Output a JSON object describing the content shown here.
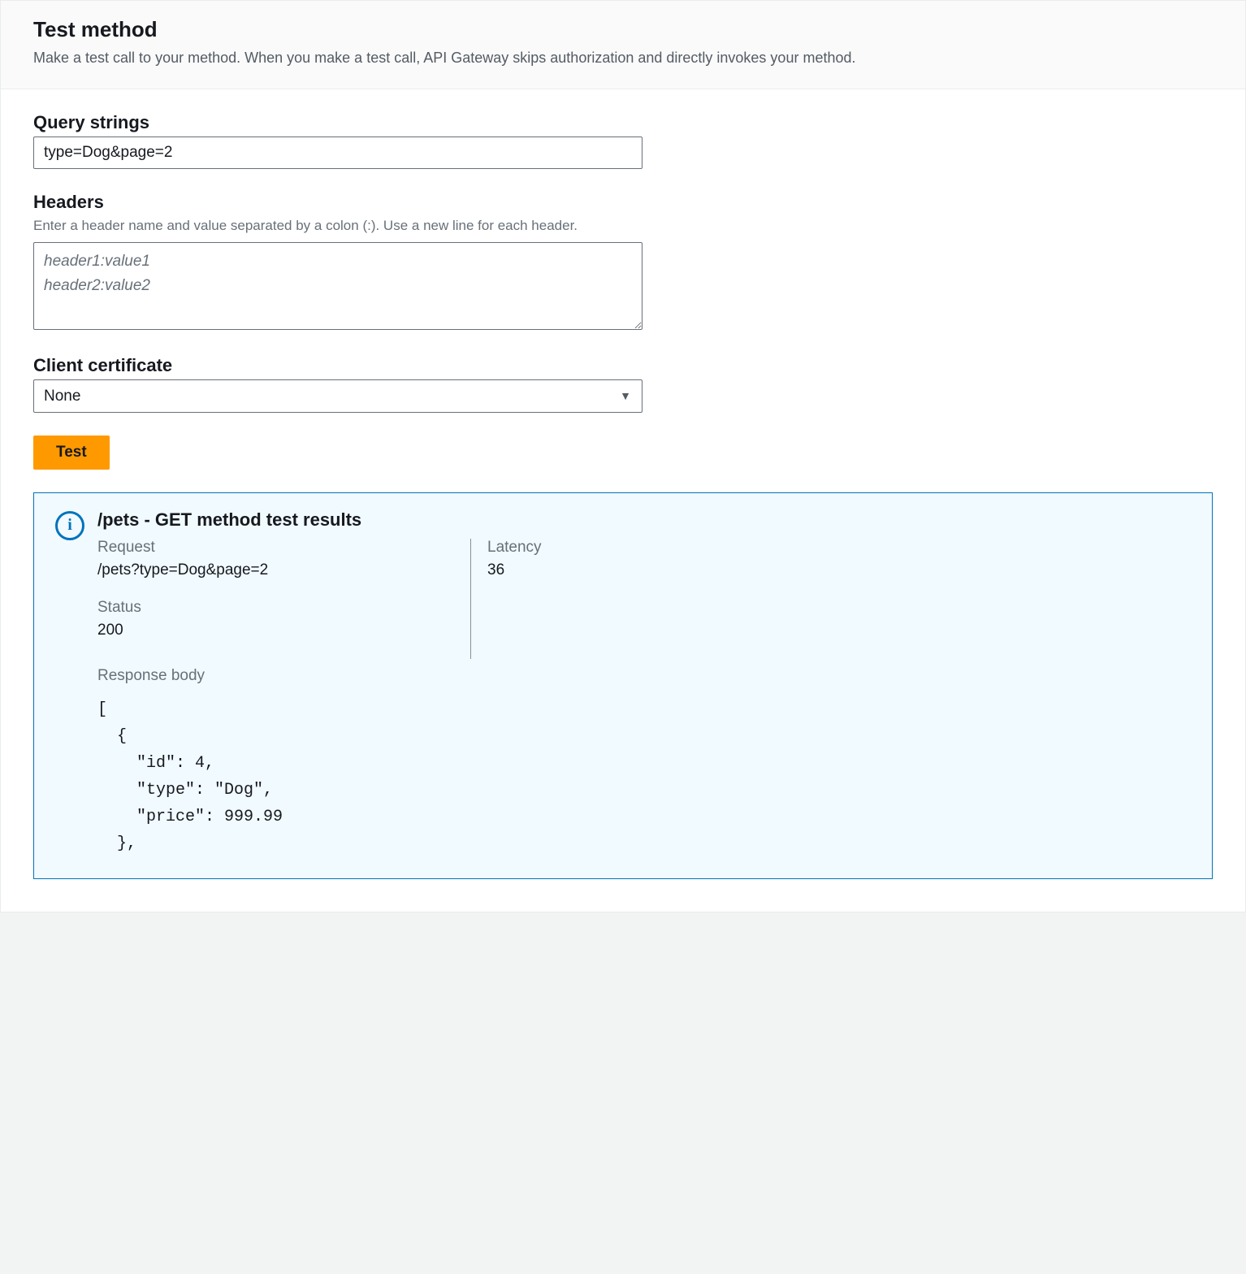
{
  "header": {
    "title": "Test method",
    "description": "Make a test call to your method. When you make a test call, API Gateway skips authorization and directly invokes your method."
  },
  "queryStrings": {
    "label": "Query strings",
    "value": "type=Dog&page=2"
  },
  "headers": {
    "label": "Headers",
    "hint": "Enter a header name and value separated by a colon (:). Use a new line for each header.",
    "placeholder": "header1:value1\nheader2:value2"
  },
  "clientCertificate": {
    "label": "Client certificate",
    "value": "None"
  },
  "testButton": {
    "label": "Test"
  },
  "results": {
    "title": "/pets - GET method test results",
    "requestLabel": "Request",
    "requestValue": "/pets?type=Dog&page=2",
    "latencyLabel": "Latency",
    "latencyValue": "36",
    "statusLabel": "Status",
    "statusValue": "200",
    "responseBodyLabel": "Response body",
    "responseBody": "[\n  {\n    \"id\": 4,\n    \"type\": \"Dog\",\n    \"price\": 999.99\n  },"
  }
}
